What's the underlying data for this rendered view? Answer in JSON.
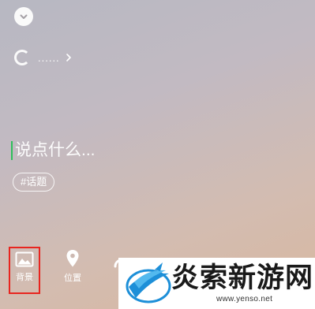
{
  "header": {
    "collapse_icon": "chevron-down-icon",
    "status_icon": "loading-spinner-icon",
    "status_text": "......",
    "status_chevron_icon": "chevron-right-icon"
  },
  "composer": {
    "placeholder": "说点什么...",
    "value": "",
    "topic_chip": "#话题",
    "cursor_color": "#2fbf5b"
  },
  "toolbar": {
    "items": [
      {
        "label": "背景",
        "icon": "image-icon",
        "highlighted": true
      },
      {
        "label": "位置",
        "icon": "location-pin-icon",
        "highlighted": false
      },
      {
        "label": "",
        "icon": "partial-icon",
        "highlighted": false
      }
    ],
    "highlight_color": "#e8251f"
  },
  "watermark": {
    "brand": "炎索新游网",
    "url": "www.yenso.net",
    "logo_icon": "bird-swoosh-logo"
  }
}
